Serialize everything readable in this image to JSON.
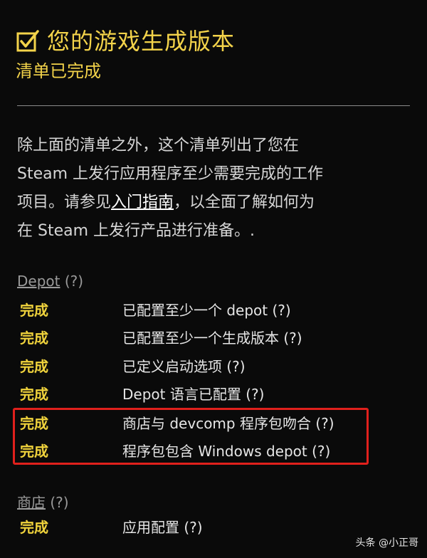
{
  "header": {
    "title": "您的游戏生成版本",
    "subtitle": "清单已完成"
  },
  "intro": {
    "line1": "除上面的清单之外，这个清单列出了您在",
    "line2": "Steam 上发行应用程序至少需要完成的工作",
    "line3_before": "项目。请参见",
    "link_text": "入门指南",
    "line3_after": "，以全面了解如何为",
    "line4": "在 Steam 上发行产品进行准备。."
  },
  "sections": {
    "depot": {
      "name": "Depot",
      "help": " (?)",
      "items": [
        {
          "status": "完成",
          "label": "已配置至少一个 depot (?)"
        },
        {
          "status": "完成",
          "label": "已配置至少一个生成版本 (?)"
        },
        {
          "status": "完成",
          "label": "已定义启动选项 (?)"
        },
        {
          "status": "完成",
          "label": "Depot 语言已配置 (?)"
        },
        {
          "status": "完成",
          "label": "商店与 devcomp 程序包吻合 (?)"
        },
        {
          "status": "完成",
          "label": "程序包包含 Windows depot (?)"
        }
      ]
    },
    "store": {
      "name": "商店",
      "help": " (?)",
      "items": [
        {
          "status": "完成",
          "label": "应用配置 (?)"
        }
      ]
    }
  },
  "watermark": {
    "text": "头条 @小正哥"
  },
  "colors": {
    "accent": "#f3d34a",
    "highlight": "#e0201c",
    "background": "#0a0a0a"
  }
}
